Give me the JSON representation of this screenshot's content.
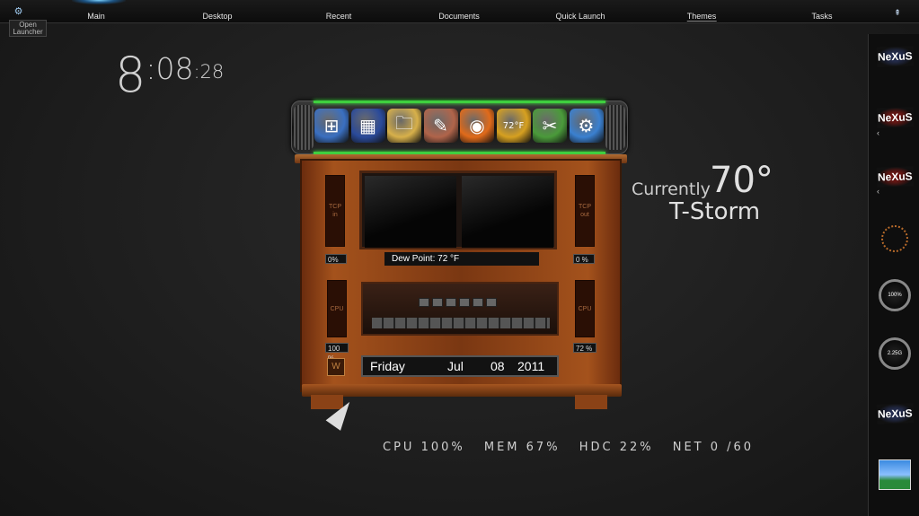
{
  "topbar": {
    "nav": [
      "Main",
      "Desktop",
      "Recent",
      "Documents",
      "Quick Launch",
      "Themes",
      "Tasks"
    ],
    "open_launcher": "Open Launcher"
  },
  "clock": {
    "hour": "8",
    "minute": ":08",
    "second": ":28"
  },
  "weather": {
    "currently_label": "Currently",
    "temperature": "70°",
    "condition": "T-Storm"
  },
  "dock": {
    "icons": [
      {
        "name": "windows-start-icon",
        "glyph": "⊞",
        "color": "#3a6fc0"
      },
      {
        "name": "sidebar-gadget-icon",
        "glyph": "▦",
        "color": "#2a4a9a"
      },
      {
        "name": "folder-icon",
        "glyph": "🗀",
        "color": "#d7b04a"
      },
      {
        "name": "paint-icon",
        "glyph": "✎",
        "color": "#b0644a"
      },
      {
        "name": "firefox-icon",
        "glyph": "◉",
        "color": "#e06a1a"
      },
      {
        "name": "weather-icon",
        "glyph": "72°F",
        "color": "#d6a020"
      },
      {
        "name": "tools-icon",
        "glyph": "✂",
        "color": "#4a9a3a"
      },
      {
        "name": "settings-gears-icon",
        "glyph": "⚙",
        "color": "#3a80d0"
      }
    ]
  },
  "cabinet": {
    "tcp_in_label": "TCP in",
    "tcp_out_label": "TCP out",
    "tcp_in_pct": "0%",
    "tcp_out_pct": "0 %",
    "cpu_left_label": "CPU",
    "cpu_right_label": "CPU",
    "cpu_left_pct": "100 %",
    "cpu_right_pct": "72 %",
    "dew_point": "Dew Point: 72 °F",
    "day": "Friday",
    "month": "Jul",
    "date": "08",
    "year": "2011"
  },
  "stats": {
    "cpu": "CPU 100%",
    "mem": "MEM 67%",
    "hdc": "HDC 22%",
    "net": "NET 0 /60"
  },
  "sidebar": {
    "gauge1": "100%",
    "gauge2": "2.25G",
    "nexus_label": "NeXuS"
  }
}
